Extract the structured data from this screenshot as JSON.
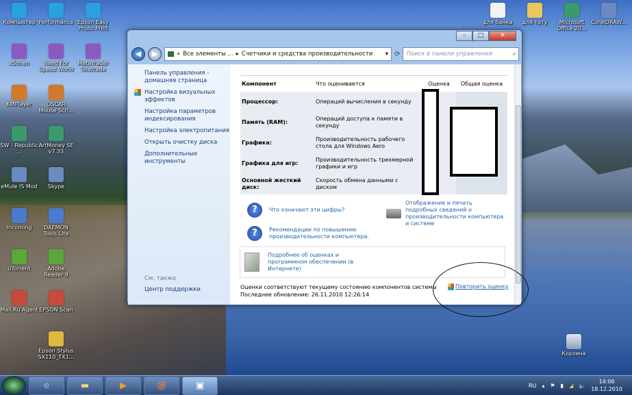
{
  "desktop": {
    "col1": [
      "Компьютер",
      "xSonen",
      "KMPlayer",
      "SW - Republic ...",
      "eMule IS Mod",
      "Incoming",
      "uTorrent",
      "Mail.Ru Agent"
    ],
    "col2": [
      "Performance",
      "Need For Speed World",
      "OSCAR Mouse Scri...",
      "ArtMoney SE v7.33",
      "Skype",
      "DAEMON Tools Lite",
      "Adobe Reader 9",
      "EPSON Scan",
      "Epson Stylus SX110_TX1..."
    ],
    "col3": [
      "Epson Easy Photo Print",
      "MetaTrader Teletrade"
    ],
    "right": [
      "для банка",
      "для тату",
      "Microsoft Office 20...",
      "CorelDRAW..."
    ],
    "recycle": "Корзина"
  },
  "window": {
    "breadcrumb": [
      "Все элементы ...",
      "Счетчики и средства производительности"
    ],
    "search_placeholder": "Поиск в панели управления",
    "left": [
      "Панель управления - домашняя страница",
      "Настройка визуальных эффектов",
      "Настройка параметров индексирования",
      "Настройка электропитания",
      "Открыть очистку диска",
      "Дополнительные инструменты"
    ],
    "see_also": "См. также",
    "support": "Центр поддержки",
    "headers": [
      "Компонент",
      "Что оценивается",
      "Оценка",
      "Общая оценка"
    ],
    "rows": [
      {
        "c": "Процессор:",
        "w": "Операций вычисления в секунду"
      },
      {
        "c": "Память (RAM):",
        "w": "Операций доступа к памяти в секунду"
      },
      {
        "c": "Графика:",
        "w": "Производительность рабочего стола для Windows Aero"
      },
      {
        "c": "Графика для игр:",
        "w": "Производительность трехмерной графики и игр"
      },
      {
        "c": "Основной жесткий диск:",
        "w": "Скорость обмена данными с диском"
      }
    ],
    "links": {
      "what": "Что означают эти цифры?",
      "tips": "Рекомендации по повышению производительности компьютера.",
      "print": "Отображение и печать подробных сведений о производительности компьютера и системе",
      "more": "Подробнее об оценках и программном обеспечении (в Интернете)",
      "rerun": "Повторить оценку"
    },
    "status": "Оценки соответствуют текущему состоянию компонентов системы",
    "updated": "Последнее обновление: 26.11.2010 12:26:14"
  },
  "tray": {
    "lang": "RU",
    "time": "14:06",
    "date": "18.12.2010"
  }
}
